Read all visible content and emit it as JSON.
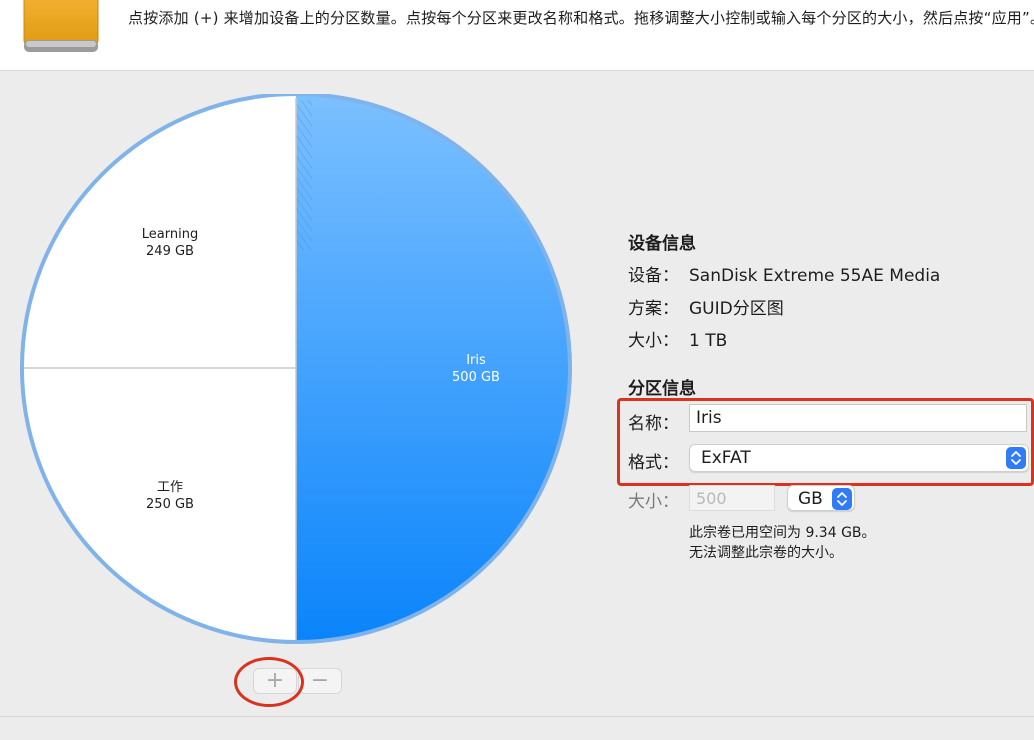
{
  "header": {
    "instruction": "点按添加 (+) 来增加设备上的分区数量。点按每个分区来更改名称和格式。拖移调整大小控制或输入每个分区的大小，然后点按“应用”。",
    "icon": "external-drive-icon"
  },
  "pie": {
    "partitions": [
      {
        "name": "Learning",
        "size": "249 GB",
        "fraction": 0.249,
        "color": "#ffffff"
      },
      {
        "name": "工作",
        "size": "250 GB",
        "fraction": 0.25,
        "color": "#ffffff"
      },
      {
        "name": "Iris",
        "size": "500 GB",
        "fraction": 0.5,
        "color": "#1f8efa",
        "selected": true
      }
    ],
    "accent_color": "#1f8efa",
    "outline_color": "#7fb3ea"
  },
  "controls": {
    "add_label": "+",
    "remove_label": "−"
  },
  "device_info": {
    "title": "设备信息",
    "device_label": "设备：",
    "device_value": "SanDisk Extreme 55AE Media",
    "scheme_label": "方案：",
    "scheme_value": "GUID分区图",
    "size_label": "大小：",
    "size_value": "1 TB"
  },
  "partition_info": {
    "title": "分区信息",
    "name_label": "名称：",
    "name_value": "Iris",
    "format_label": "格式：",
    "format_value": "ExFAT",
    "size_label": "大小：",
    "size_value": "500",
    "size_unit": "GB",
    "note_used": "此宗卷已用空间为 9.34 GB。",
    "note_resize": "无法调整此宗卷的大小。"
  },
  "colors": {
    "highlight": "#d9321f",
    "stepper": "#2f7cf6"
  }
}
